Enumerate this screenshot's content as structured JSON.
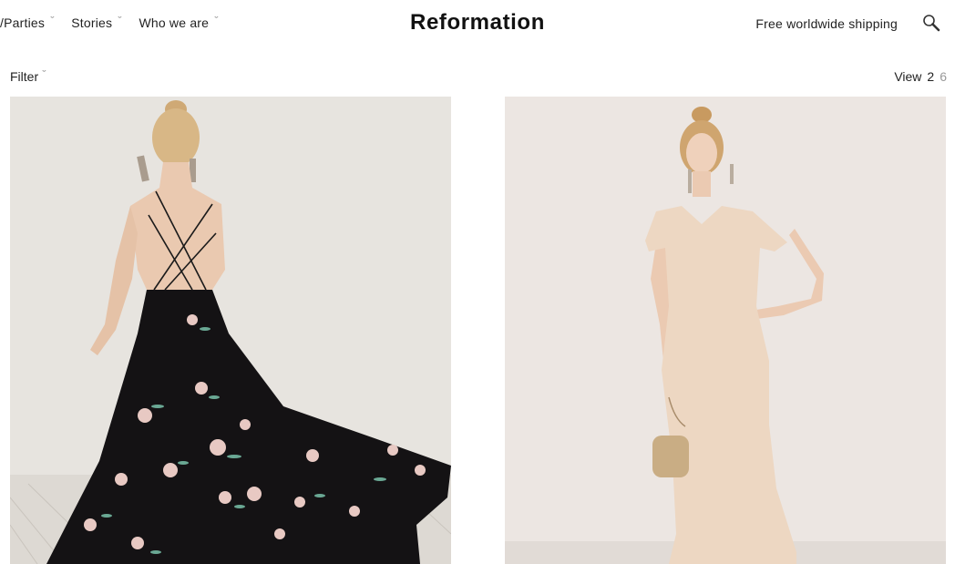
{
  "header": {
    "nav": [
      {
        "label": "/Parties"
      },
      {
        "label": "Stories"
      },
      {
        "label": "Who we are"
      }
    ],
    "logo": "Reformation",
    "shipping": "Free worldwide shipping",
    "search_icon": "search-icon"
  },
  "toolbar": {
    "filter_label": "Filter",
    "view_label": "View",
    "view_options": [
      "2",
      "6"
    ],
    "view_selected": "2"
  },
  "products": [
    {
      "image": "black-floral-backless-maxi-dress",
      "colors": {
        "dress": "#141214",
        "backdrop": "#e7e4df",
        "floral": "#e8c9c3"
      }
    },
    {
      "image": "blush-cap-sleeve-mermaid-gown",
      "colors": {
        "dress": "#edd7c2",
        "backdrop": "#ece6e2"
      }
    }
  ]
}
